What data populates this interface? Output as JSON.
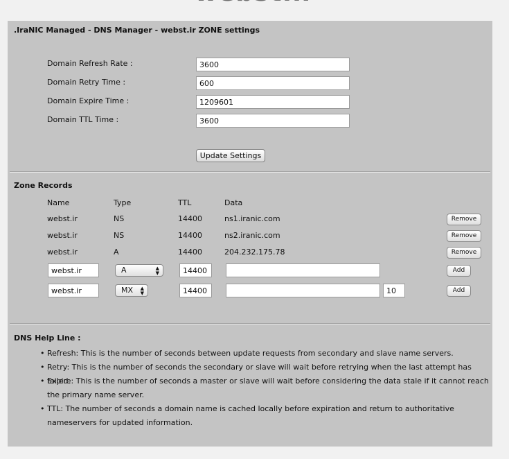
{
  "site": {
    "logo_text": "webst.ir"
  },
  "panel": {
    "title": ".IraNIC Managed - DNS Manager - webst.ir ZONE settings"
  },
  "settings": {
    "fields": [
      {
        "label": "Domain Refresh Rate :",
        "value": "3600"
      },
      {
        "label": "Domain Retry Time :",
        "value": "600"
      },
      {
        "label": "Domain Expire Time :",
        "value": "1209601"
      },
      {
        "label": "Domain TTL Time :",
        "value": "3600"
      }
    ],
    "update_button": "Update Settings"
  },
  "zone": {
    "title": "Zone Records",
    "headers": {
      "name": "Name",
      "type": "Type",
      "ttl": "TTL",
      "data": "Data"
    },
    "records": [
      {
        "name": "webst.ir",
        "type": "NS",
        "ttl": "14400",
        "data": "ns1.iranic.com",
        "action": "Remove"
      },
      {
        "name": "webst.ir",
        "type": "NS",
        "ttl": "14400",
        "data": "ns2.iranic.com",
        "action": "Remove"
      },
      {
        "name": "webst.ir",
        "type": "A",
        "ttl": "14400",
        "data": "204.232.175.78",
        "action": "Remove"
      }
    ],
    "new_rows": [
      {
        "name": "webst.ir",
        "type": "A",
        "ttl": "14400",
        "data": "",
        "action": "Add"
      },
      {
        "name": "webst.ir",
        "type": "MX",
        "ttl": "14400",
        "data": "",
        "priority": "10",
        "action": "Add"
      }
    ],
    "arrow_up": "▲",
    "arrow_down": "▼"
  },
  "help": {
    "title": "DNS Help Line :",
    "bullet": "•",
    "items": [
      "Refresh: This is the number of seconds between update requests from secondary and slave name servers.",
      "Retry: This is the number of seconds the secondary or slave will wait before retrying when the last attempt has failed.",
      "Expire: This is the number of seconds a master or slave will wait before considering the data stale if it cannot reach the primary name server.",
      "TTL: The number of seconds a domain name is cached locally before expiration and return to authoritative nameservers for updated information."
    ]
  }
}
